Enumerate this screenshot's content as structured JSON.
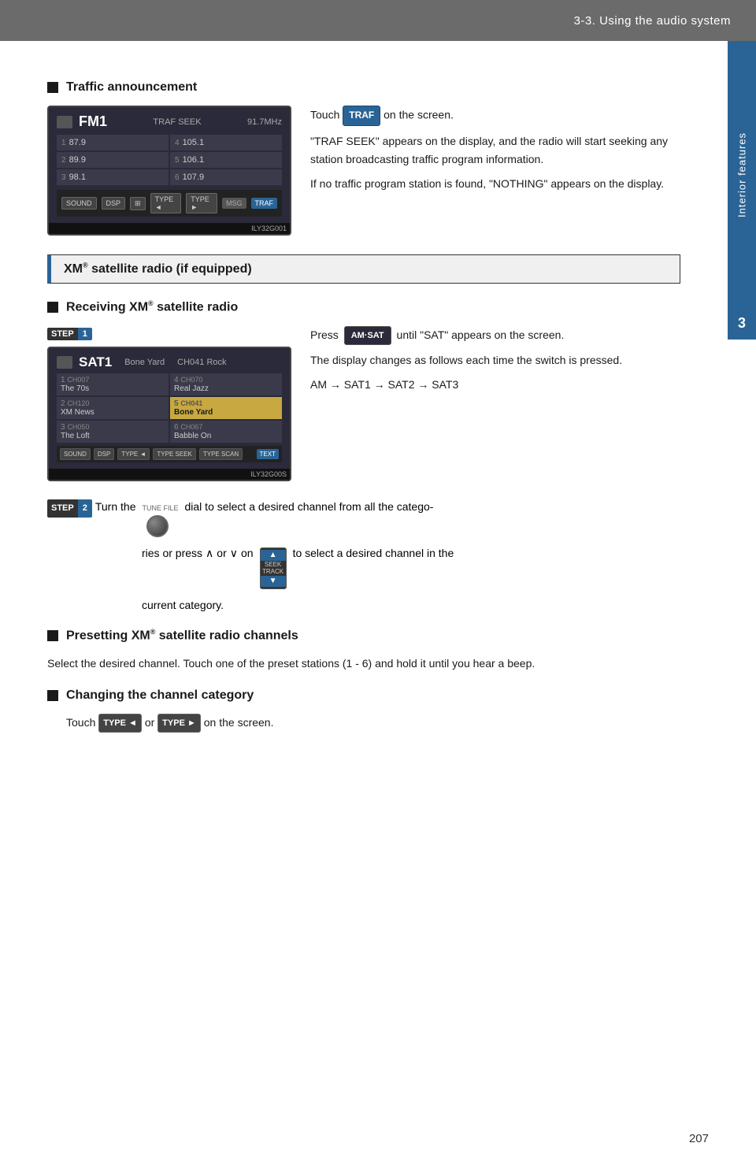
{
  "header": {
    "title": "3-3. Using the audio system"
  },
  "sidebar": {
    "tab_label": "Interior features",
    "chapter_num": "3"
  },
  "sections": {
    "traffic_heading": "Traffic announcement",
    "traffic_instruction": "Touch",
    "traf_button_label": "TRAF",
    "traffic_instruction_suffix": "on the screen.",
    "traffic_para1": "\"TRAF SEEK\" appears on the display, and the radio will start seeking any station broadcasting traffic program information.",
    "traffic_para2": "If no traffic program station is found, \"NOTHING\" appears on the display.",
    "xm_section_title": "XM® satellite radio (if equipped)",
    "receiving_heading": "Receiving XM® satellite radio",
    "step1_label": "STEP",
    "step1_num": "1",
    "press_instruction": "Press",
    "amsat_label": "AM·SAT",
    "press_suffix": "until \"SAT\" appears on the screen.",
    "display_changes": "The display changes as follows each time the switch is pressed.",
    "am_sequence": "AM → SAT1 → SAT2 → SAT3",
    "step2_label": "STEP",
    "step2_num": "2",
    "step2_text1": "Turn the",
    "step2_text2": "dial to select a desired channel from all the catego-",
    "step2_text3": "ries or press",
    "step2_wedge1": "∧",
    "step2_or": "or",
    "step2_wedge2": "∨",
    "step2_on": "on",
    "step2_text4": "to select a desired channel in the",
    "step2_text5": "current category.",
    "tune_file_label": "TUNE FILE",
    "seek_track_up": "▲",
    "seek_track_label": "SEEK TRACK",
    "seek_track_down": "▼",
    "presetting_heading": "Presetting XM® satellite radio channels",
    "presetting_text": "Select the desired channel. Touch one of the preset stations (1 - 6) and hold it until you hear a beep.",
    "changing_heading": "Changing the channel category",
    "changing_text1": "Touch",
    "changing_type_left": "TYPE ◄",
    "changing_or": "or",
    "changing_type_right": "TYPE ►",
    "changing_text2": "on the screen.",
    "page_number": "207",
    "radio_fm1": "FM1",
    "radio_tags": "TRAF  SEEK",
    "radio_freq": "91.7MHz",
    "radio_presets": [
      {
        "num": "1",
        "freq": "87.9"
      },
      {
        "num": "4",
        "freq": "105.1"
      },
      {
        "num": "2",
        "freq": "89.9"
      },
      {
        "num": "5",
        "freq": "106.1"
      },
      {
        "num": "3",
        "freq": "98.1"
      },
      {
        "num": "6",
        "freq": "107.9"
      }
    ],
    "image_label1": "ILY32G001",
    "sat1_name": "SAT1",
    "sat1_channel": "Bone Yard",
    "sat1_ch_info": "CH041 Rock",
    "sat_presets": [
      {
        "num": "1",
        "ch": "CH007",
        "name": "The 70s",
        "highlight": false
      },
      {
        "num": "4",
        "ch": "CH070",
        "name": "Real Jazz",
        "highlight": false
      },
      {
        "num": "2",
        "ch": "CH120",
        "name": "XM News",
        "highlight": false
      },
      {
        "num": "5",
        "ch": "CH041",
        "name": "Bone Yard",
        "highlight": true
      },
      {
        "num": "3",
        "ch": "CH050",
        "name": "The Loft",
        "highlight": false
      },
      {
        "num": "6",
        "ch": "CH067",
        "name": "Babble On",
        "highlight": false
      }
    ],
    "image_label2": "ILY32G00S"
  }
}
